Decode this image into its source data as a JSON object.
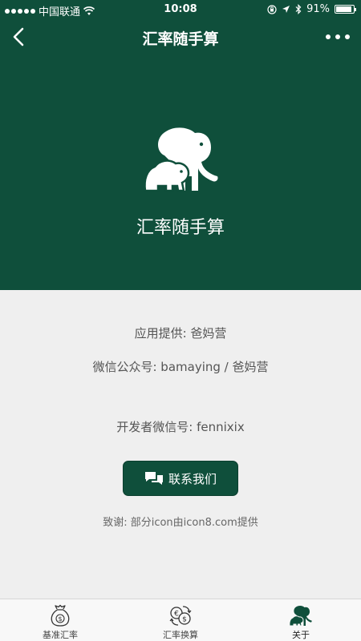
{
  "status_bar": {
    "carrier": "中国联通",
    "time": "10:08",
    "battery": "91%",
    "battery_level": 0.91
  },
  "nav": {
    "title": "汇率随手算",
    "back_icon": "chevron-left-icon",
    "more_icon": "more-dots-icon"
  },
  "hero": {
    "app_name": "汇率随手算",
    "logo_icon": "elephant-icon"
  },
  "info": {
    "provider": "应用提供: 爸妈营",
    "wechat_account": "微信公众号: bamaying / 爸妈营",
    "developer_wechat": "开发者微信号: fennixix"
  },
  "contact_button": {
    "label": "联系我们",
    "icon": "chat-bubbles-icon"
  },
  "thanks": "致谢: 部分icon由icon8.com提供",
  "tabs": [
    {
      "label": "基准汇率",
      "icon": "money-bag-icon",
      "active": false
    },
    {
      "label": "汇率换算",
      "icon": "currency-exchange-icon",
      "active": false
    },
    {
      "label": "关于",
      "icon": "elephant-icon",
      "active": true
    }
  ],
  "colors": {
    "brand": "#0f4f3b",
    "background": "#efefef"
  }
}
